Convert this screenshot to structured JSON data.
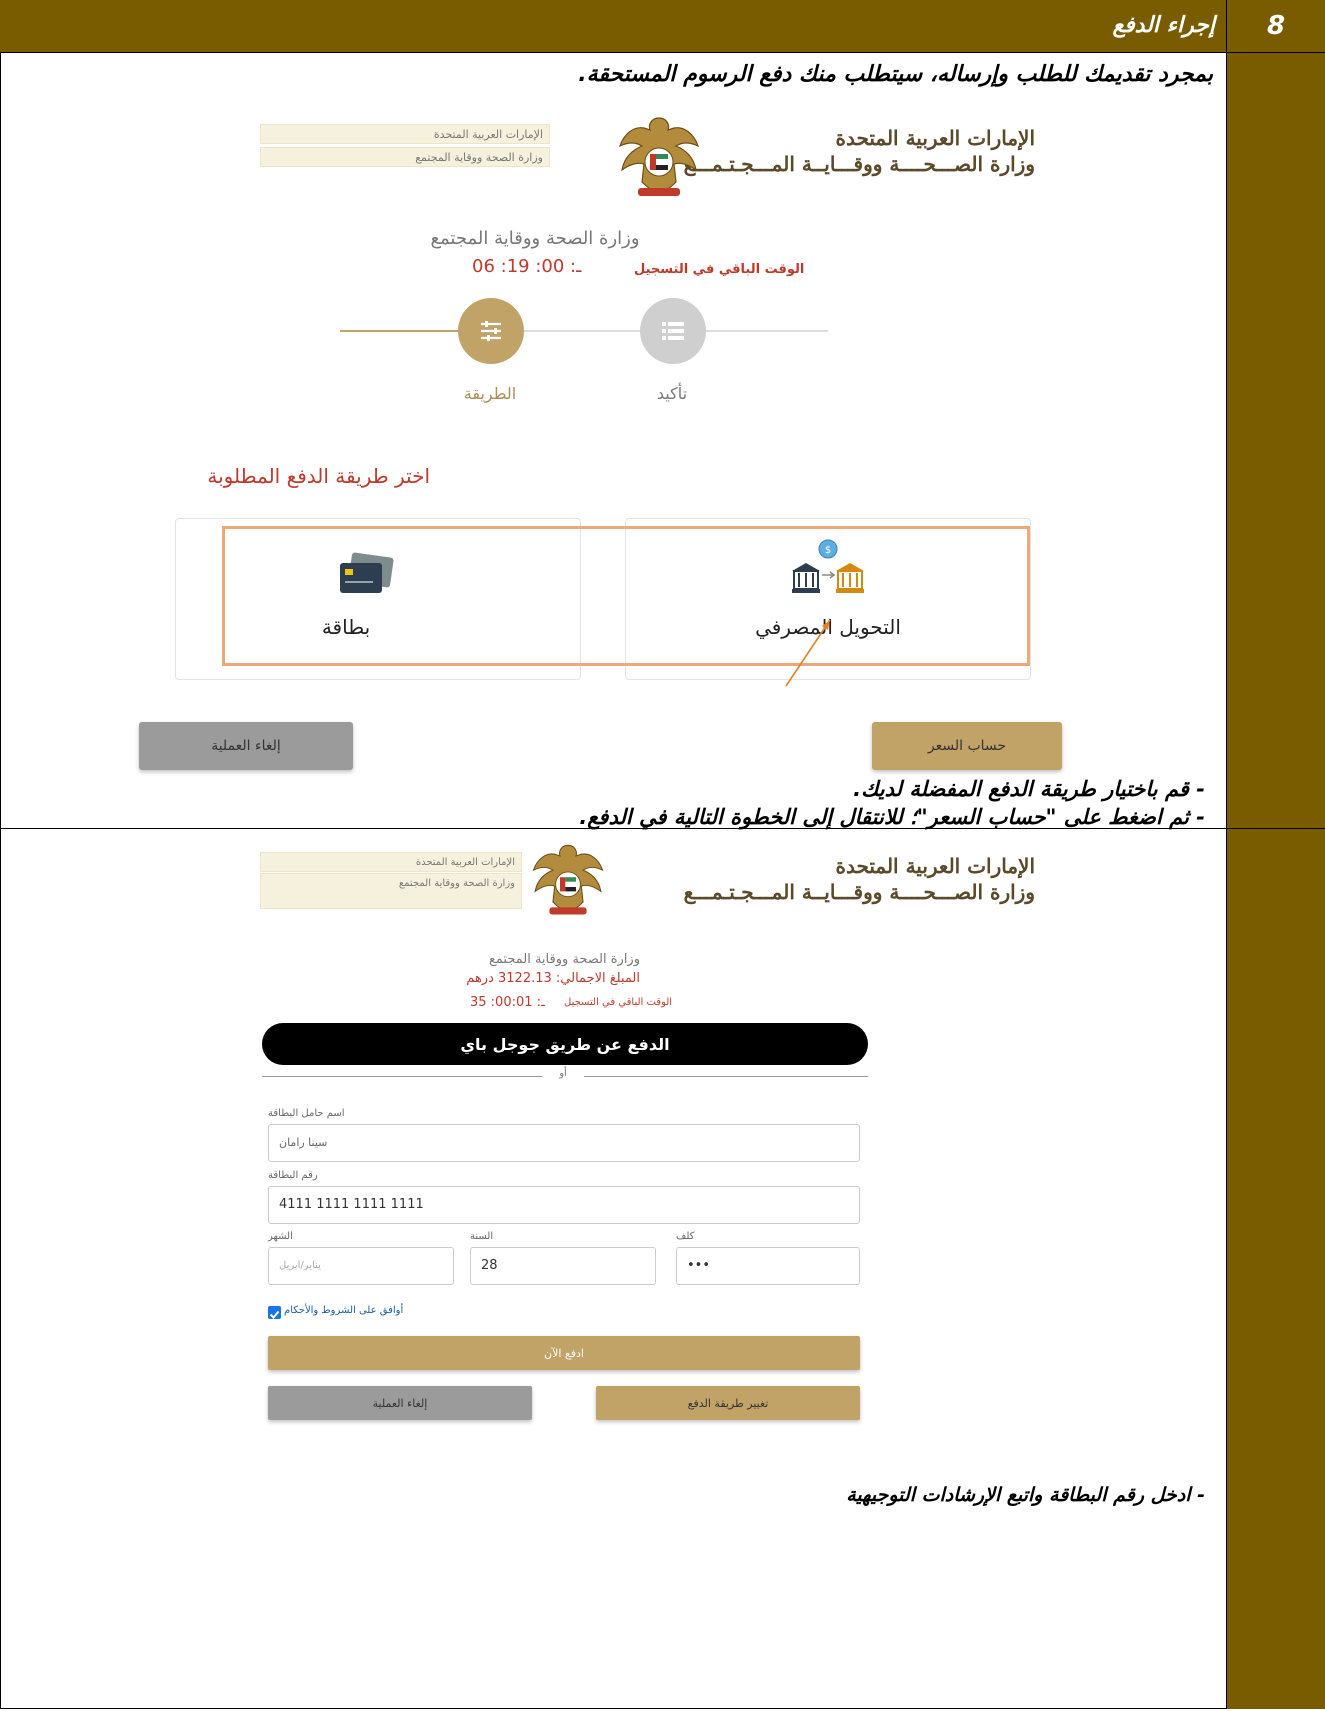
{
  "section": {
    "number": "8",
    "title": "إجراء الدفع"
  },
  "intro": "بمجرد تقديمك للطلب وإرساله، سيتطلب منك دفع الرسوم المستحقة.",
  "screen1": {
    "gov_title_line1": "الإمارات العربية المتحدة",
    "gov_title_line2": "وزارة الصـــحــــة ووقـــايــة المـــجـتـمـــع",
    "field1": "الإمارات العربية المتحدة",
    "field2": "وزارة الصحة ووقاية المجتمع",
    "ministry_name": "وزارة الصحة ووقاية المجتمع",
    "timer_label": "الوقت الباقي في التسجيل",
    "timer_value": "06 :19 :00 :ـ",
    "step_method": "الطريقة",
    "step_confirm": "تأكيد",
    "choose_heading": "اختر طريقة الدفع المطلوبة",
    "option_card": "بطاقة",
    "option_bank": "التحويل المصرفي",
    "btn_cancel": "إلغاء العملية",
    "btn_calc": "حساب السعر"
  },
  "notes1": [
    "- قم باختيار طريقة الدفع المفضلة لديك.",
    "- ثم اضغط على \"حساب السعر\"؛ للانتقال إلى الخطوة التالية في الدفع."
  ],
  "screen2": {
    "gov_title_line1": "الإمارات العربية المتحدة",
    "gov_title_line2": "وزارة الصـــحــــة ووقـــايــة المـــجـتـمـــع",
    "field1": "الإمارات العربية المتحدة",
    "field2": "وزارة الصحة ووقاية المجتمع",
    "ministry_name": "وزارة الصحة ووقاية المجتمع",
    "total_amount": "المبلغ الاجمالي: 3122.13 درهم",
    "timer_label": "الوقت الباقي في التسجيل",
    "timer_value": "35 :00:01 :ـ",
    "gpay_label": "الدفع عن طريق جوجل باي",
    "or_label": "أو",
    "cardholder_label": "اسم حامل البطاقة",
    "cardholder_value": "سينا رامان",
    "cardnumber_label": "رقم البطاقة",
    "cardnumber_value": "4111 1111 1111 1111",
    "month_label": "الشهر",
    "month_placeholder": "يناير/ابريل",
    "year_label": "السنة",
    "year_value": "28",
    "cvv_label": "كلف",
    "cvv_value": "•••",
    "terms_label": "أوافق على الشروط والأحكام",
    "btn_pay": "ادفع الآن",
    "btn_cancel": "إلغاء العملية",
    "btn_change": "تغيير طريقة الدفع"
  },
  "notes2": [
    "- ادخل رقم البطاقة واتبع الإرشادات التوجيهية"
  ],
  "colors": {
    "header_band": "#7a5c00",
    "gold": "#c2a367",
    "grey_button": "#9b9b9b",
    "accent_red": "#c0392b",
    "highlight_orange": "#f0a878"
  }
}
